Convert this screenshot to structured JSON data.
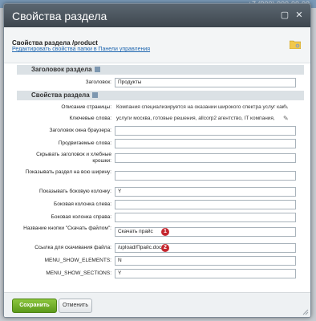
{
  "window": {
    "title": "Свойства раздела",
    "bg_phone": "+7 (900) 000-00-00"
  },
  "header": {
    "line1": "Свойства раздела /product",
    "link": "Редактировать свойства папки в Панели управления"
  },
  "sections": {
    "heading": "Заголовок раздела",
    "props": "Свойства раздела"
  },
  "fields": {
    "heading_label": "Заголовок:",
    "heading_value": "Продукты",
    "desc_label": "Описание страницы:",
    "desc_value": "Компания специализируется на оказании широкого спектра услуг как",
    "keywords_label": "Ключевые слова:",
    "keywords_value": "услуги москва, готовые решения, allcorp2 агентство, IT компания,",
    "browser_title_label": "Заголовок окна браузера:",
    "promoted_label": "Продвигаемые слова:",
    "hide_title_label": "Скрывать заголовок и хлебные крошки:",
    "full_width_label": "Показывать раздел на всю ширину:",
    "side_col_label": "Показывать боковую колонку:",
    "side_col_value": "Y",
    "left_col_label": "Боковая колонка слева:",
    "right_col_label": "Боковая колонка справа:",
    "btn_name_label": "Название кнопки \"Скачать файлом\":",
    "btn_name_value": "Скачать прайс",
    "download_label": "Ссылка для скачивания файла:",
    "download_value": "/upload/Прайс.docx",
    "menu_elements_label": "MENU_SHOW_ELEMENTS:",
    "menu_elements_value": "N",
    "menu_sections_label": "MENU_SHOW_SECTIONS:",
    "menu_sections_value": "Y"
  },
  "badges": {
    "b1": "1",
    "b2": "2"
  },
  "footer": {
    "save": "Сохранить",
    "cancel": "Отменить"
  },
  "colors": {
    "save_green": "#6aab24",
    "badge_red": "#c4262e",
    "link_blue": "#2067b0"
  }
}
